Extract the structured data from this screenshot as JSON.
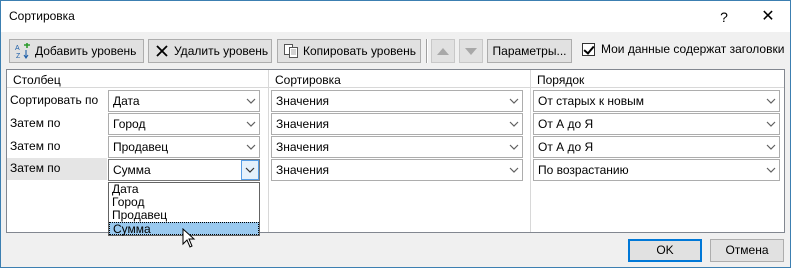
{
  "window": {
    "title": "Сортировка",
    "help_glyph": "?",
    "close_glyph": "✕"
  },
  "toolbar": {
    "add_level": "Добавить уровень",
    "delete_level": "Удалить уровень",
    "copy_level": "Копировать уровень",
    "options": "Параметры...",
    "headers_checkbox_label": "Мои данные содержат заголовки",
    "headers_checked": true
  },
  "columns": {
    "column": "Столбец",
    "sort_on": "Сортировка",
    "order": "Порядок"
  },
  "rows": [
    {
      "label": "Сортировать по",
      "column": "Дата",
      "sort_on": "Значения",
      "order": "От старых к новым"
    },
    {
      "label": "Затем по",
      "column": "Город",
      "sort_on": "Значения",
      "order": "От А до Я"
    },
    {
      "label": "Затем по",
      "column": "Продавец",
      "sort_on": "Значения",
      "order": "От А до Я"
    },
    {
      "label": "Затем по",
      "column": "Сумма",
      "sort_on": "Значения",
      "order": "По возрастанию"
    }
  ],
  "dropdown_options": [
    "Дата",
    "Город",
    "Продавец",
    "Сумма"
  ],
  "dropdown_selected": "Сумма",
  "footer": {
    "ok": "OK",
    "cancel": "Отмена"
  },
  "colors": {
    "accent": "#0078d7",
    "selection": "#99c9ef",
    "window_border": "#3c7fb1"
  }
}
